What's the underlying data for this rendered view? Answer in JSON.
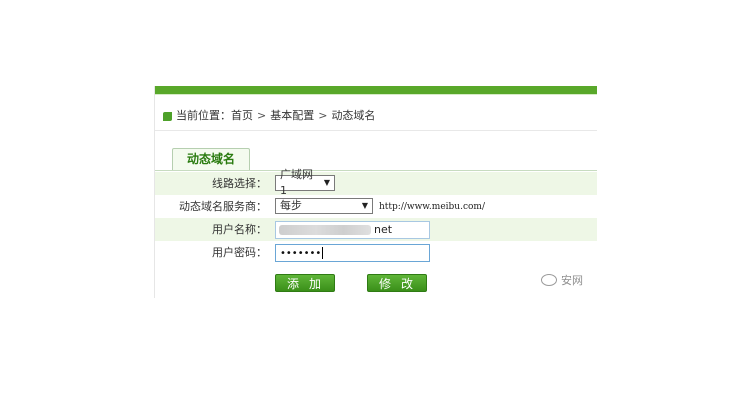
{
  "breadcrumb": {
    "prefix": "当前位置：",
    "items": [
      "首页",
      "基本配置",
      "动态域名"
    ],
    "sep": ">"
  },
  "tab": {
    "label": "动态域名"
  },
  "form": {
    "line": {
      "label": "线路选择：",
      "value": "广域网1"
    },
    "provider": {
      "label": "动态域名服务商：",
      "value": "每步",
      "hint": "http://www.meibu.com/"
    },
    "username": {
      "label": "用户名称：",
      "value_suffix": "net"
    },
    "password": {
      "label": "用户密码：",
      "value": "•••••••"
    }
  },
  "buttons": {
    "add": "添加",
    "edit": "修改"
  },
  "watermark": {
    "text": "安网"
  },
  "colors": {
    "accent": "#59a82a",
    "button": "#3a8f19",
    "row_shade": "#eef7e6"
  },
  "icons": {
    "breadcrumb": "leaf-icon",
    "watermark": "wechat-icon"
  }
}
